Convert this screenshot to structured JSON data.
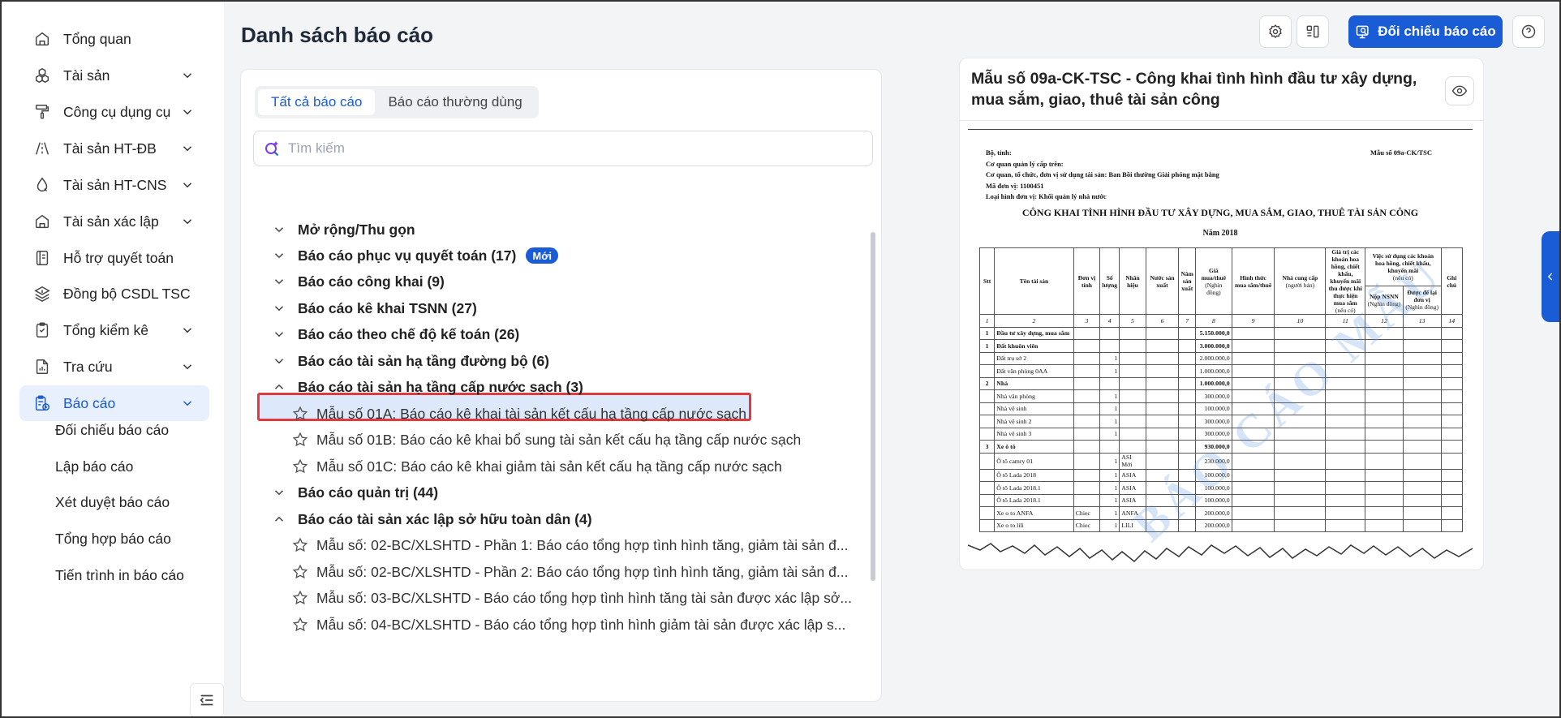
{
  "sidebar": {
    "items": [
      {
        "label": "Tổng quan",
        "icon": "home-icon",
        "expandable": false
      },
      {
        "label": "Tài sản",
        "icon": "boxes-icon",
        "expandable": true
      },
      {
        "label": "Công cụ dụng cụ",
        "icon": "paint-roller-icon",
        "expandable": true
      },
      {
        "label": "Tài sản HT-ĐB",
        "icon": "road-icon",
        "expandable": true
      },
      {
        "label": "Tài sản HT-CNS",
        "icon": "water-drop-icon",
        "expandable": true
      },
      {
        "label": "Tài sản xác lập",
        "icon": "home-icon",
        "expandable": true
      },
      {
        "label": "Hỗ trợ quyết toán",
        "icon": "book-icon",
        "expandable": false
      },
      {
        "label": "Đồng bộ CSDL TSC",
        "icon": "layers-icon",
        "expandable": false
      },
      {
        "label": "Tổng kiểm kê",
        "icon": "clipboard-icon",
        "expandable": true
      },
      {
        "label": "Tra cứu",
        "icon": "report-chart-icon",
        "expandable": true
      },
      {
        "label": "Báo cáo",
        "icon": "report-icon",
        "expandable": true,
        "active": true
      }
    ],
    "sub_items": [
      "Đối chiếu báo cáo",
      "Lập báo cáo",
      "Xét duyệt báo cáo",
      "Tổng hợp báo cáo",
      "Tiến trình in báo cáo"
    ]
  },
  "header": {
    "title": "Danh sách báo cáo",
    "compare_button": "Đối chiếu báo cáo"
  },
  "list": {
    "tabs": [
      "Tất cả báo cáo",
      "Báo cáo thường dùng"
    ],
    "search_placeholder": "Tìm kiếm",
    "expand_all": "Mở rộng/Thu gọn",
    "new_badge": "Mới",
    "groups": [
      "Báo cáo phục vụ quyết toán (17)",
      "Báo cáo công khai (9)",
      "Báo cáo kê khai TSNN (27)",
      "Báo cáo theo chế độ kế toán (26)",
      "Báo cáo tài sản hạ tầng đường bộ (6)",
      "Báo cáo tài sản hạ tầng cấp nước sạch (3)",
      "Báo cáo quản trị (44)",
      "Báo cáo tài sản xác lập sở hữu toàn dân (4)"
    ],
    "water_reports": [
      "Mẫu số 01A: Báo cáo kê khai tài sản kết cấu hạ tầng cấp nước sạch",
      "Mẫu số 01B: Báo cáo kê khai bổ sung tài sản kết cấu hạ tầng cấp nước sạch",
      "Mẫu số 01C: Báo cáo kê khai giảm tài sản kết cấu hạ tầng cấp nước sạch"
    ],
    "public_reports": [
      "Mẫu số: 02-BC/XLSHTD - Phần 1: Báo cáo tổng hợp tình hình tăng, giảm tài sản đ...",
      "Mẫu số: 02-BC/XLSHTD - Phần 2: Báo cáo tổng hợp tình hình tăng, giảm tài sản đ...",
      "Mẫu số: 03-BC/XLSHTD - Báo cáo tổng hợp tình hình tăng tài sản được xác lập sở...",
      "Mẫu số: 04-BC/XLSHTD - Báo cáo tổng hợp tình hình giảm tài sản được xác lập s..."
    ]
  },
  "preview": {
    "title": "Mẫu số 09a-CK-TSC - Công khai tình hình đầu tư xây dựng, mua sắm, giao, thuê tài sản công",
    "doc": {
      "meta": [
        "Bộ, tỉnh:",
        "Cơ quan quản lý cấp trên:",
        "Cơ quan, tổ chức, đơn vị sử dụng tài sản: Ban Bồi thường Giải phóng mặt bằng",
        "Mã đơn vị: 1100451",
        "Loại hình đơn vị: Khối quản lý nhà nước"
      ],
      "form_no": "Mẫu số 09a-CK/TSC",
      "title": "CÔNG KHAI TÌNH HÌNH ĐẦU TƯ XÂY DỰNG, MUA SẮM, GIAO, THUÊ TÀI SẢN CÔNG",
      "year": "Năm 2018",
      "watermark": "BÁO CÁO MẪU",
      "headers": {
        "stt": "Stt",
        "name": "Tên tài sản",
        "unit": "Đơn vị tính",
        "qty": "Số lượng",
        "brand": "Nhãn hiệu",
        "origin": "Nước sản xuất",
        "year": "Năm sản xuất",
        "price": "Giá mua/thuê",
        "price_unit": "(Nghìn đồng)",
        "form": "Hình thức mua sắm/thuê",
        "supplier": "Nhà cung cấp",
        "supplier_note": "(người bán)",
        "discount": "Giá trị các khoản hoa hồng, chiết khấu, khuyến mãi thu được khi thực hiện mua sắm",
        "discount_note": "(nếu có)",
        "usage": "Việc sử dụng các khoản hoa hồng, chiết khấu, khuyến mãi",
        "usage_note": "(nếu có)",
        "nsnn": "Nộp NSNN",
        "nsnn_unit": "(Nghìn đồng)",
        "kept": "Được để lại đơn vị",
        "kept_unit": "(Nghìn đồng)",
        "note": "Ghi chú"
      },
      "col_numbers": [
        "1",
        "2",
        "3",
        "4",
        "5",
        "6",
        "7",
        "8",
        "9",
        "10",
        "11",
        "12",
        "13",
        "14"
      ],
      "rows": [
        {
          "stt": "1",
          "name": "Đầu tư xây dựng, mua sắm",
          "unit": "",
          "qty": "",
          "brand": "",
          "price": "5.150.000,0",
          "bold": true
        },
        {
          "stt": "1",
          "name": "Đất khuôn viên",
          "unit": "",
          "qty": "",
          "brand": "",
          "price": "3.000.000,0",
          "bold": true
        },
        {
          "stt": "",
          "name": "Đất trụ sở 2",
          "unit": "",
          "qty": "1",
          "brand": "",
          "price": "2.000.000,0"
        },
        {
          "stt": "",
          "name": "Đất văn phòng 0AA",
          "unit": "",
          "qty": "1",
          "brand": "",
          "price": "1.000.000,0"
        },
        {
          "stt": "2",
          "name": "Nhà",
          "unit": "",
          "qty": "",
          "brand": "",
          "price": "1.000.000,0",
          "bold": true
        },
        {
          "stt": "",
          "name": "Nhà văn phòng",
          "unit": "",
          "qty": "1",
          "brand": "",
          "price": "300.000,0"
        },
        {
          "stt": "",
          "name": "Nhà vệ sinh",
          "unit": "",
          "qty": "1",
          "brand": "",
          "price": "100.000,0"
        },
        {
          "stt": "",
          "name": "Nhà vệ sinh 2",
          "unit": "",
          "qty": "1",
          "brand": "",
          "price": "300.000,0"
        },
        {
          "stt": "",
          "name": "Nhà vệ sinh 3",
          "unit": "",
          "qty": "1",
          "brand": "",
          "price": "300.000,0"
        },
        {
          "stt": "3",
          "name": "Xe ô tô",
          "unit": "",
          "qty": "",
          "brand": "",
          "price": "930.000,0",
          "bold": true
        },
        {
          "stt": "",
          "name": "Ô tô camry 01",
          "unit": "",
          "qty": "1",
          "brand": "ASI Mới",
          "price": "230.000,0"
        },
        {
          "stt": "",
          "name": "Ô tô Lada 2018",
          "unit": "",
          "qty": "1",
          "brand": "ASIA",
          "price": "100.000,0"
        },
        {
          "stt": "",
          "name": "Ô tô Lada 2018.1",
          "unit": "",
          "qty": "1",
          "brand": "ASIA",
          "price": "100.000,0"
        },
        {
          "stt": "",
          "name": "Ô tô Lada 2018.1",
          "unit": "",
          "qty": "1",
          "brand": "ASIA",
          "price": "100.000,0"
        },
        {
          "stt": "",
          "name": "Xe o to ANFA",
          "unit": "Chiec",
          "qty": "1",
          "brand": "ANFA",
          "price": "200.000,0"
        },
        {
          "stt": "",
          "name": "Xe o to lili",
          "unit": "Chiec",
          "qty": "1",
          "brand": "LILI",
          "price": "200.000,0"
        }
      ]
    }
  }
}
